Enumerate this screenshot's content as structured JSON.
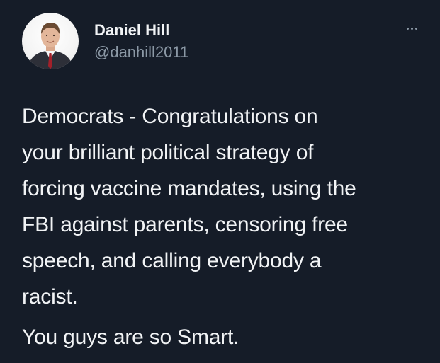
{
  "author": {
    "display_name": "Daniel Hill",
    "handle": "@danhill2011"
  },
  "icons": {
    "more": "more-horizontal-icon",
    "avatar": "profile-photo"
  },
  "tweet": {
    "paragraph1_lines": [
      "Democrats  -  Congratulations on",
      "your brilliant political strategy of",
      "forcing vaccine mandates, using the",
      "FBI against parents, censoring free",
      "speech, and calling everybody a",
      "racist."
    ],
    "paragraph2": "You guys are so Smart."
  },
  "colors": {
    "background": "#151c28",
    "primary_text": "#f1f3f5",
    "secondary_text": "#8b98a5"
  }
}
